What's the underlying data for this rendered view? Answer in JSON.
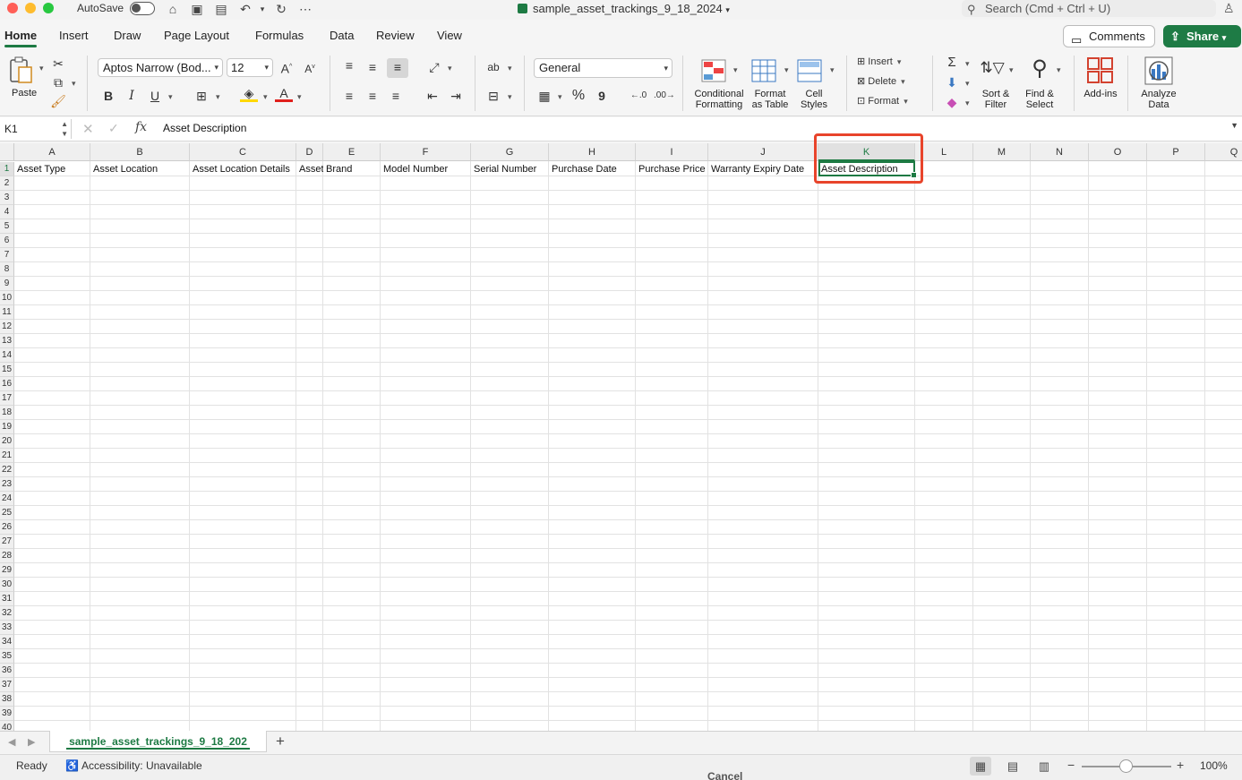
{
  "titlebar": {
    "autosave_label": "AutoSave",
    "file_title": "sample_asset_trackings_9_18_2024",
    "search_placeholder": "Search (Cmd + Ctrl + U)"
  },
  "tabs": [
    "Home",
    "Insert",
    "Draw",
    "Page Layout",
    "Formulas",
    "Data",
    "Review",
    "View"
  ],
  "active_tab": "Home",
  "actions": {
    "comments": "Comments",
    "share": "Share"
  },
  "ribbon": {
    "paste": "Paste",
    "font_name": "Aptos Narrow (Bod...",
    "font_size": "12",
    "bold": "B",
    "italic": "I",
    "underline": "U",
    "number_format": "General",
    "percent": "%",
    "comma": "9",
    "conditional_formatting": [
      "Conditional",
      "Formatting"
    ],
    "format_as_table": [
      "Format",
      "as Table"
    ],
    "cell_styles": [
      "Cell",
      "Styles"
    ],
    "insert": "Insert",
    "delete": "Delete",
    "format": "Format",
    "sort_filter": [
      "Sort &",
      "Filter"
    ],
    "find_select": [
      "Find &",
      "Select"
    ],
    "add_ins": "Add-ins",
    "analyze_data": [
      "Analyze",
      "Data"
    ]
  },
  "formula_bar": {
    "name_box": "K1",
    "fx": "fx",
    "content": "Asset Description"
  },
  "columns": [
    "A",
    "B",
    "C",
    "D",
    "E",
    "F",
    "G",
    "H",
    "I",
    "J",
    "K",
    "L",
    "M",
    "N",
    "O",
    "P",
    "Q"
  ],
  "rows": [
    "1",
    "2",
    "3",
    "4",
    "5",
    "6",
    "7",
    "8",
    "9",
    "10",
    "11",
    "12",
    "13",
    "14",
    "15",
    "16",
    "17",
    "18",
    "19",
    "20",
    "21",
    "22",
    "23",
    "24",
    "25",
    "26",
    "27",
    "28",
    "29",
    "30",
    "31",
    "32",
    "33",
    "34",
    "35",
    "36",
    "37",
    "38",
    "39",
    "40"
  ],
  "row1": [
    "Asset Type",
    "Asset Location",
    "Asset Location Details",
    "Asset",
    "Brand",
    "Model Number",
    "Serial Number",
    "Purchase Date",
    "Purchase Price",
    "Warranty Expiry Date",
    "Asset Description"
  ],
  "selected_cell": "K1",
  "sheet": {
    "tab_name": "sample_asset_trackings_9_18_202",
    "add": "+"
  },
  "status": {
    "ready": "Ready",
    "accessibility": "Accessibility: Unavailable",
    "cancel_ghost": "Cancel",
    "zoom": "100%"
  }
}
